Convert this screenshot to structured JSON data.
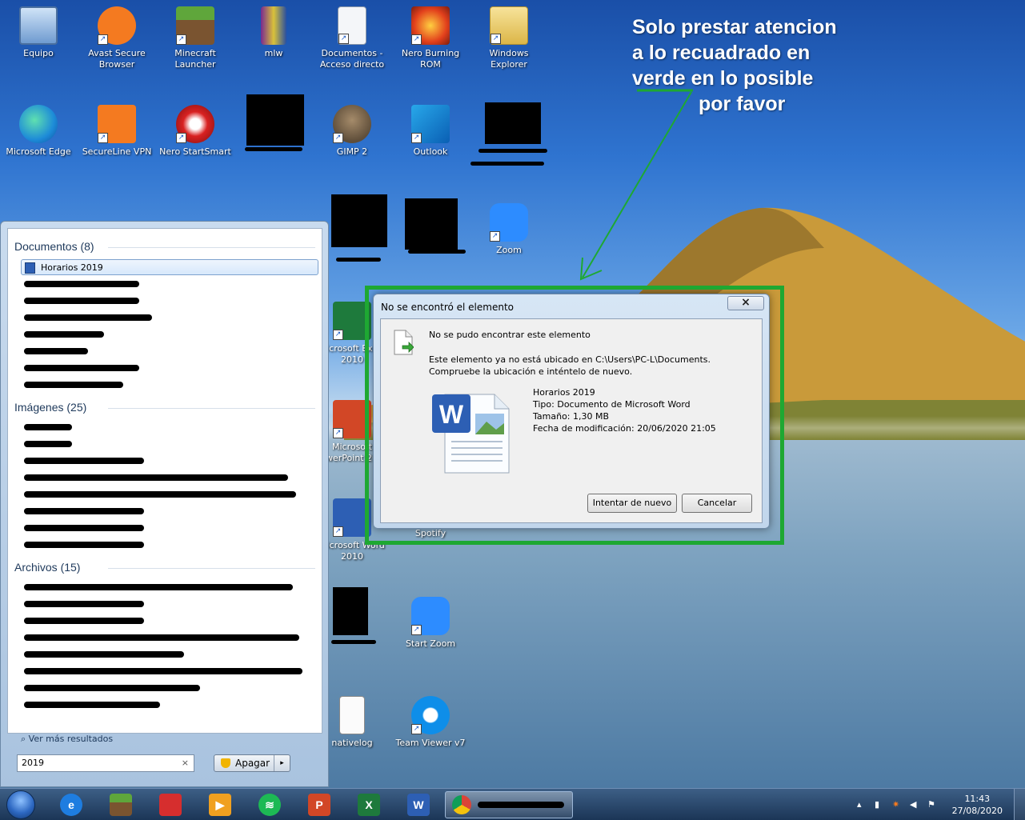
{
  "desktop": {
    "icons": [
      {
        "id": "equipo",
        "label": "Equipo"
      },
      {
        "id": "avast",
        "label": "Avast Secure Browser"
      },
      {
        "id": "minecraft",
        "label": "Minecraft Launcher"
      },
      {
        "id": "mlw",
        "label": "mlw"
      },
      {
        "id": "documentos",
        "label": "Documentos - Acceso directo"
      },
      {
        "id": "nero-burning",
        "label": "Nero Burning ROM"
      },
      {
        "id": "windows-explorer",
        "label": "Windows Explorer"
      },
      {
        "id": "edge",
        "label": "Microsoft Edge"
      },
      {
        "id": "secureline",
        "label": "SecureLine VPN"
      },
      {
        "id": "nero-startsmart",
        "label": "Nero StartSmart"
      },
      {
        "id": "gimp",
        "label": "GIMP 2"
      },
      {
        "id": "outlook",
        "label": "Outlook"
      },
      {
        "id": "zoom",
        "label": "Zoom"
      },
      {
        "id": "excel",
        "label": "Microsoft Excel 2010"
      },
      {
        "id": "powerpoint",
        "label": "Microsoft PowerPoint 2010"
      },
      {
        "id": "word",
        "label": "Microsoft Word 2010"
      },
      {
        "id": "spotify",
        "label": "Spotify"
      },
      {
        "id": "start-zoom",
        "label": "Start Zoom"
      },
      {
        "id": "nativelog",
        "label": "nativelog"
      },
      {
        "id": "teamviewer",
        "label": "Team Viewer v7"
      }
    ]
  },
  "annotation": {
    "line1": "Solo prestar atencion",
    "line2": "a lo recuadrado en",
    "line3": "verde en lo posible",
    "line4": "por favor"
  },
  "dialog": {
    "title": "No se encontró el elemento",
    "close": "×",
    "heading": "No se pudo encontrar este elemento",
    "message": "Este elemento ya no está ubicado en C:\\Users\\PC-L\\Documents. Compruebe la ubicación e inténtelo de nuevo.",
    "file_name": "Horarios 2019",
    "file_type": "Tipo: Documento de Microsoft Word",
    "file_size": "Tamaño: 1,30 MB",
    "file_modified": "Fecha de modificación: 20/06/2020 21:05",
    "retry_label": "Intentar de nuevo",
    "cancel_label": "Cancelar"
  },
  "start_menu": {
    "documents_header": "Documentos (8)",
    "documents_first": "Horarios 2019",
    "images_header": "Imágenes (25)",
    "files_header": "Archivos (15)",
    "more_results": "Ver más resultados",
    "search_value": "2019",
    "search_clear": "×",
    "shutdown_label": "Apagar",
    "shutdown_arrow": "▸"
  },
  "taskbar": {
    "time": "11:43",
    "date": "27/08/2020"
  },
  "colors": {
    "highlight": "#1ea832",
    "word_blue": "#2d5fb4",
    "excel_green": "#1e7a3c"
  }
}
